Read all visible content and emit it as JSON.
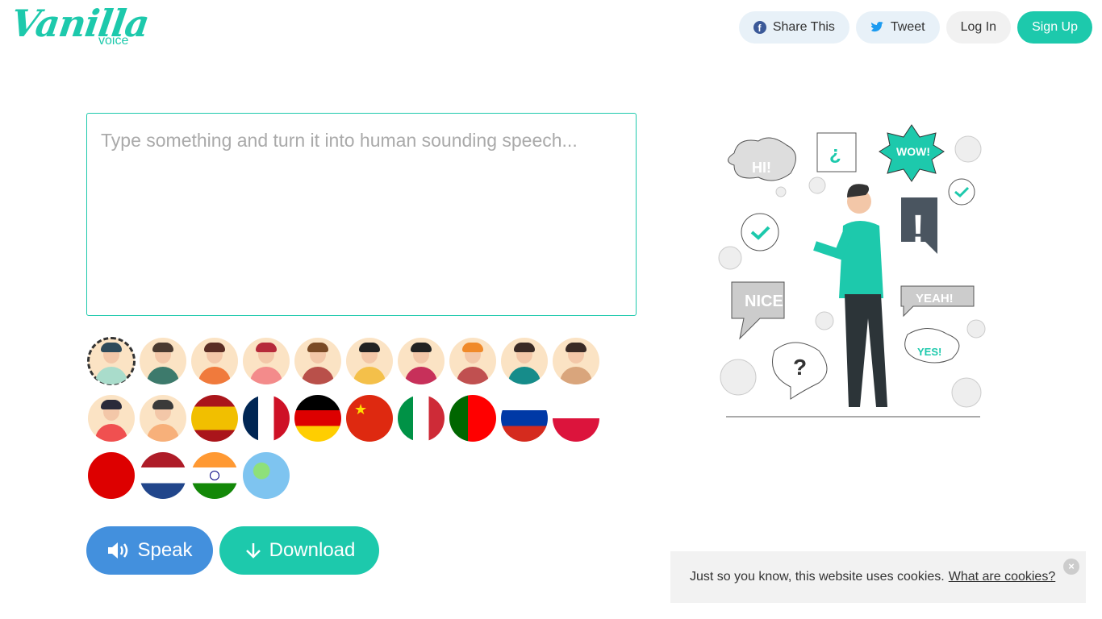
{
  "logo": {
    "name": "Vanilla",
    "sub": "voice"
  },
  "nav": {
    "share": "Share This",
    "tweet": "Tweet",
    "login": "Log In",
    "signup": "Sign Up"
  },
  "editor": {
    "placeholder": "Type something and turn it into human sounding speech...",
    "value": ""
  },
  "voices": {
    "selected_index": 0,
    "avatars": [
      {
        "hair": "#2e4a5a",
        "shirt": "#a9dccb"
      },
      {
        "hair": "#4a3a30",
        "shirt": "#3d7a6c"
      },
      {
        "hair": "#5a2d24",
        "shirt": "#f07a3c"
      },
      {
        "hair": "#b62a3a",
        "shirt": "#f38b8b"
      },
      {
        "hair": "#7a4a25",
        "shirt": "#b9504a"
      },
      {
        "hair": "#222",
        "shirt": "#f4c04a"
      },
      {
        "hair": "#222",
        "shirt": "#c7305a"
      },
      {
        "hair": "#f08a2a",
        "shirt": "#c05050"
      },
      {
        "hair": "#3a2a25",
        "shirt": "#168c8a"
      },
      {
        "hair": "#3a2a25",
        "shirt": "#d9a57c"
      },
      {
        "hair": "#2a2a3a",
        "shirt": "#f05050"
      },
      {
        "hair": "#3a3a3a",
        "shirt": "#f7b07a"
      }
    ],
    "flags": [
      "spain",
      "france",
      "germany",
      "china",
      "italy",
      "portugal",
      "russia",
      "poland",
      "japan",
      "netherlands",
      "india",
      "world"
    ]
  },
  "actions": {
    "speak": "Speak",
    "download": "Download"
  },
  "illustration": {
    "hi": "HI!",
    "inv_q": "¿",
    "wow": "WOW!",
    "nice": "NICE!",
    "yeah": "YEAH!",
    "yes": "YES!",
    "q": "?",
    "excl": "!"
  },
  "cookie": {
    "text": "Just so you know, this website uses cookies.",
    "link": "What are cookies?",
    "close": "×"
  },
  "colors": {
    "brand": "#1dc9ac",
    "speak": "#4390dd"
  }
}
